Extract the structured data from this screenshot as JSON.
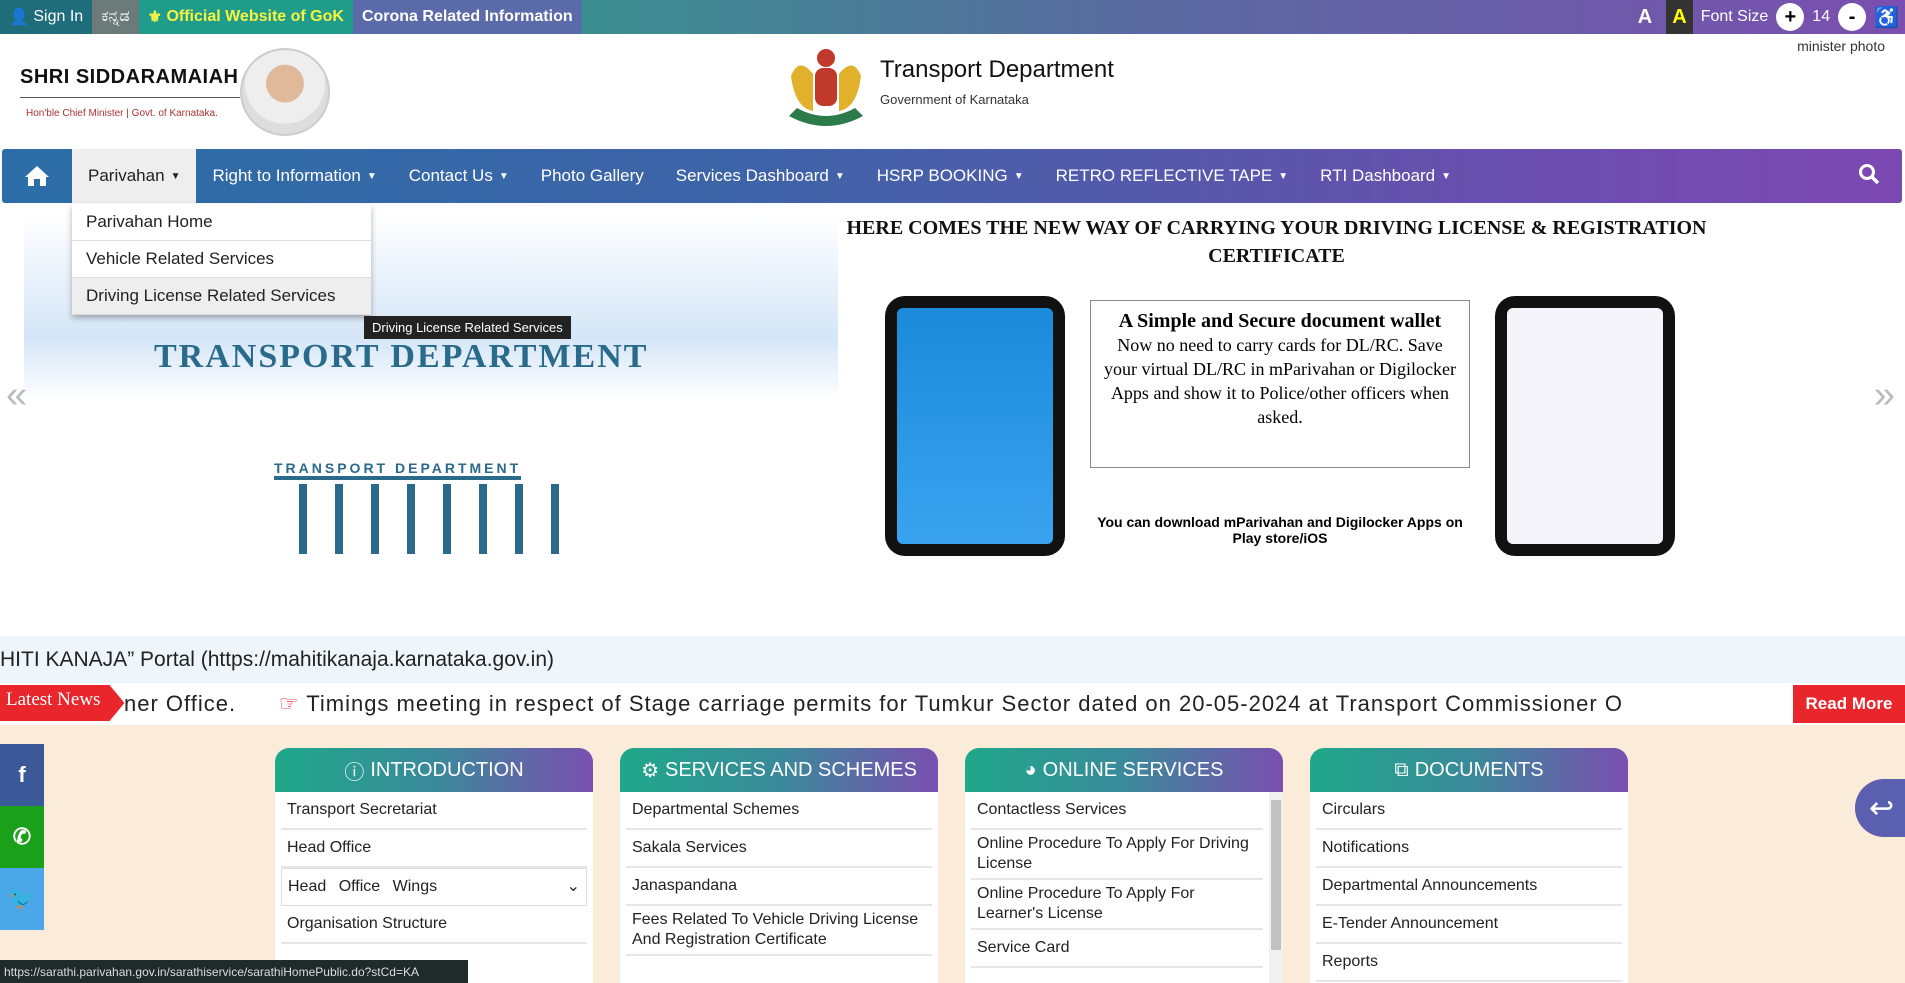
{
  "topbar": {
    "sign_in": "Sign In",
    "kannada": "ಕನ್ನಡ",
    "gok": "Official Website of GoK",
    "corona": "Corona Related Information",
    "font_a": "A",
    "font_a_alt": "A",
    "font_size_label": "Font Size",
    "font_plus": "+",
    "font_value": "14",
    "font_minus": "-"
  },
  "header": {
    "cm_name": "SHRI SIDDARAMAIAH",
    "cm_sub": "Hon'ble Chief Minister | Govt. of Karnataka.",
    "dept_title": "Transport Department",
    "dept_sub": "Government of Karnataka",
    "minister_photo_alt": "minister photo"
  },
  "nav": {
    "items": [
      {
        "label": "Parivahan"
      },
      {
        "label": "Right to Information"
      },
      {
        "label": "Contact Us"
      },
      {
        "label": "Photo Gallery"
      },
      {
        "label": "Services Dashboard"
      },
      {
        "label": "HSRP BOOKING"
      },
      {
        "label": "RETRO REFLECTIVE TAPE"
      },
      {
        "label": "RTI Dashboard"
      }
    ],
    "dropdown": [
      "Parivahan Home",
      "Vehicle Related Services",
      "Driving License Related Services"
    ],
    "tooltip": "Driving License Related Services"
  },
  "banner": {
    "left_title": "TRANSPORT DEPARTMENT",
    "left_sub": "TRANSPORT DEPARTMENT",
    "right_heading": "HERE COMES THE NEW WAY OF CARRYING YOUR DRIVING LICENSE & REGISTRATION CERTIFICATE",
    "wallet_title": "A Simple and Secure document wallet",
    "wallet_text": "Now no need to carry cards for DL/RC. Save your virtual DL/RC in mParivahan or Digilocker Apps and show it to Police/other officers when asked.",
    "download": "You can download mParivahan and Digilocker Apps on Play store/iOS"
  },
  "marquee": "HITI KANAJA” Portal (https://mahitikanaja.karnataka.gov.in)",
  "news": {
    "label": "Latest News",
    "prev": "ner Office.",
    "current": "Timings meeting in respect of Stage carriage permits for Tumkur Sector dated on 20-05-2024 at Transport Commissioner O",
    "read_more": "Read More"
  },
  "cards": [
    {
      "title": "INTRODUCTION",
      "items": [
        "Transport Secretariat",
        "Head Office",
        "Head Office Wings",
        "Organisation Structure"
      ]
    },
    {
      "title": "SERVICES AND SCHEMES",
      "items": [
        "Departmental Schemes",
        "Sakala Services",
        "Janaspandana",
        "Fees Related To Vehicle Driving License And Registration Certificate"
      ]
    },
    {
      "title": "ONLINE SERVICES",
      "items": [
        "Contactless Services",
        "Online Procedure To Apply For Driving License",
        "Online Procedure To Apply For Learner's License",
        "Service Card"
      ]
    },
    {
      "title": "DOCUMENTS",
      "items": [
        "Circulars",
        "Notifications",
        "Departmental Announcements",
        "E-Tender Announcement",
        "Reports"
      ]
    }
  ],
  "status_url": "https://sarathi.parivahan.gov.in/sarathiservice/sarathiHomePublic.do?stCd=KA",
  "colors": {
    "news_red": "#e8262b",
    "nav_start": "#2b6ea7",
    "nav_end": "#7c48b2"
  }
}
